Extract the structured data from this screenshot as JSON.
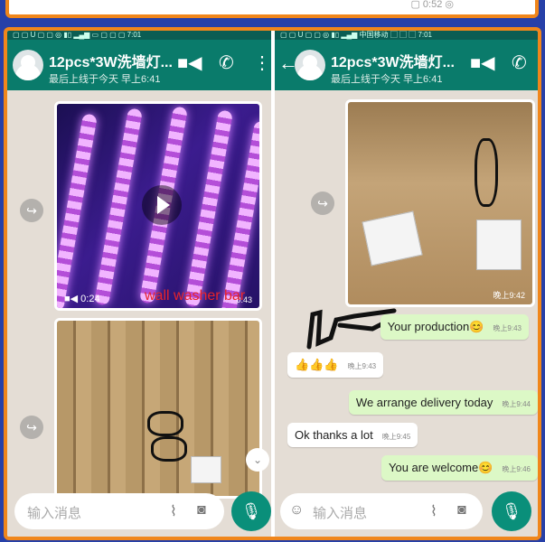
{
  "top_frame": {
    "peek_text": "▢ 0:52 ◎"
  },
  "left": {
    "status_text": "▢ ▢ U ▢ ▢    ◎ ▮▯ ▂▄▆ ▭ ▢ ▢ ▢ 7:01",
    "header": {
      "title": "12pcs*3W洗墙灯...",
      "subtitle": "最后上线于今天 早上6:41"
    },
    "video": {
      "duration": "0:24",
      "time": "0:43"
    },
    "caption": "wall washer bar",
    "input_placeholder": "输入消息"
  },
  "right": {
    "status_text": "▢ ▢ U ▢ ▢    ◎ ▮▯ ▂▄▆ 中国移动 ▢ ▢ ▢ 7:01",
    "header": {
      "title": "12pcs*3W洗墙灯...",
      "subtitle": "最后上线于今天 早上6:41"
    },
    "image_time": "晚上9:42",
    "messages": [
      {
        "dir": "out",
        "text": "Your production😊",
        "time": "晚上9:43"
      },
      {
        "dir": "in",
        "text": "👍👍👍",
        "time": "晚上9:43"
      },
      {
        "dir": "out",
        "text": "We arrange delivery today",
        "time": "晚上9:44"
      },
      {
        "dir": "in",
        "text": "Ok thanks a lot",
        "time": "晚上9:45"
      },
      {
        "dir": "out",
        "text": "You are welcome😊",
        "time": "晚上9:46"
      }
    ],
    "input_placeholder": "输入消息"
  },
  "colors": {
    "frame": "#f0861b",
    "header": "#0a7b6b",
    "chat_bg": "#e4ddd5",
    "outgoing": "#dcf8c6",
    "caption": "#e8232a"
  },
  "icons": [
    "back-arrow-icon",
    "video-call-icon",
    "phone-icon",
    "menu-icon",
    "forward-icon",
    "play-icon",
    "camcorder-icon",
    "attach-icon",
    "camera-icon",
    "mic-icon",
    "emoji-icon",
    "chevron-down-icon"
  ]
}
